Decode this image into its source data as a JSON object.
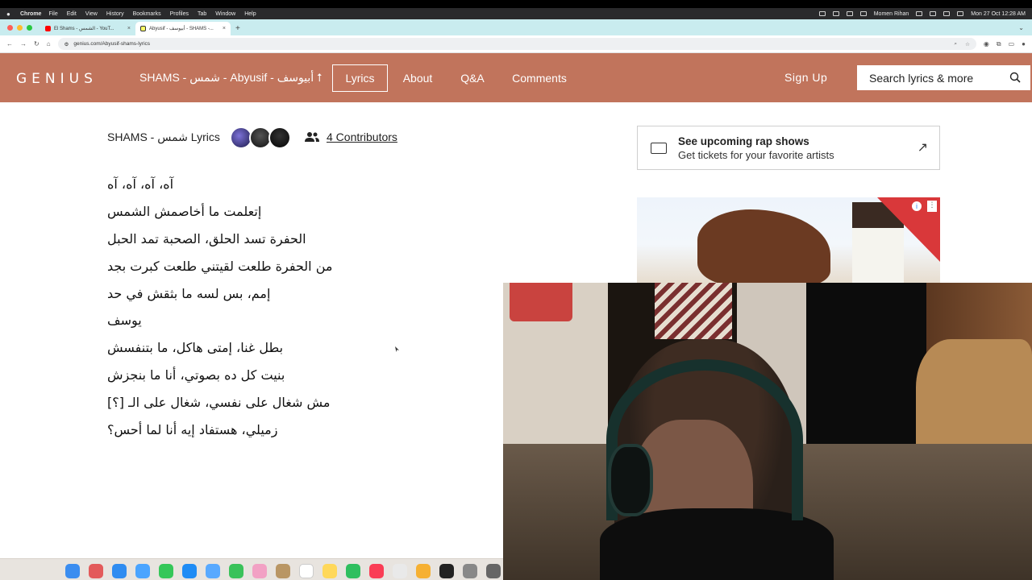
{
  "menubar": {
    "app": "Chrome",
    "items": [
      "File",
      "Edit",
      "View",
      "History",
      "Bookmarks",
      "Profiles",
      "Tab",
      "Window",
      "Help"
    ],
    "user": "Momen Rihan",
    "datetime": "Mon 27 Oct  12:28 AM"
  },
  "tabs": [
    {
      "title": "El Shams - الشمس - YouT..."
    },
    {
      "title": "Abyusif - أبيوسف - SHAMS -..."
    }
  ],
  "address": {
    "url": "genius.com/Abyusif-shams-lyrics"
  },
  "header": {
    "logo": "GENIUS",
    "song_title": "SHAMS - شمس - Abyusif - أبيوسف",
    "nav": {
      "lyrics": "Lyrics",
      "about": "About",
      "qa": "Q&A",
      "comments": "Comments"
    },
    "sign_up": "Sign Up",
    "search_placeholder": "Search lyrics & more"
  },
  "lyrics": {
    "title": "SHAMS - شمس Lyrics",
    "contributors": "4 Contributors",
    "lines": [
      "آه، آه، آه، آه",
      "إتعلمت ما أخاصمش الشمس",
      "الحفرة تسد الحلق، الصحبة تمد الحبل",
      "من الحفرة طلعت لقيتني طلعت كبرت بجد",
      "إمم، بس لسه ما بثقش في حد",
      "يوسف",
      "بطل غنا، إمتى هاكل، ما بتنفسش",
      "بنيت كل ده بصوتي، أنا ما بنجزش",
      "مش شغال على نفسي، شغال على الـ [؟]",
      "زميلي، هستفاد إيه أنا لما أحس؟"
    ]
  },
  "promo": {
    "heading": "See upcoming rap shows",
    "sub": "Get tickets for your favorite artists"
  },
  "colors": {
    "genius_header": "#c1745c",
    "tab_strip": "#c9ecef"
  }
}
